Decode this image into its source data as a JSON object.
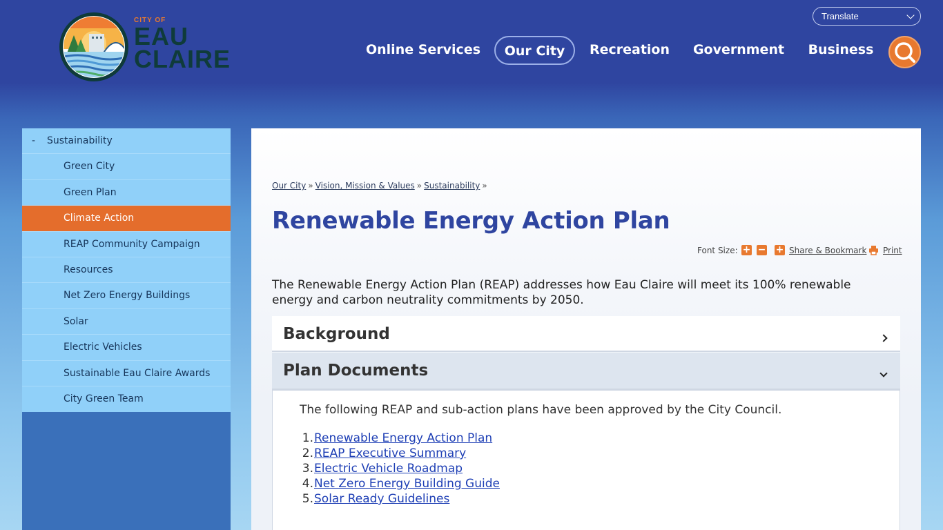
{
  "header": {
    "logo_small": "CITY OF",
    "logo_line1": "EAU",
    "logo_line2": "CLAIRE",
    "translate_label": "Translate",
    "nav": [
      {
        "label": "Online Services"
      },
      {
        "label": "Our City"
      },
      {
        "label": "Recreation"
      },
      {
        "label": "Government"
      },
      {
        "label": "Business"
      }
    ],
    "active_nav": "Our City"
  },
  "sidebar": {
    "parent": {
      "marker": "-",
      "label": "Sustainability"
    },
    "items": [
      {
        "label": "Green City"
      },
      {
        "label": "Green Plan"
      },
      {
        "label": "Climate Action"
      },
      {
        "label": "REAP Community Campaign"
      },
      {
        "label": "Resources"
      },
      {
        "label": "Net Zero Energy Buildings"
      },
      {
        "label": "Solar"
      },
      {
        "label": "Electric Vehicles"
      },
      {
        "label": "Sustainable Eau Claire Awards"
      },
      {
        "label": "City Green Team"
      }
    ],
    "active_item": "Climate Action"
  },
  "breadcrumb": {
    "items": [
      "Our City",
      "Vision, Mission & Values",
      "Sustainability"
    ],
    "separator": "»"
  },
  "page": {
    "title": "Renewable Energy Action Plan",
    "font_size_label": "Font Size:",
    "font_increase": "+",
    "font_decrease": "−",
    "share_label": "Share & Bookmark",
    "print_label": "Print",
    "intro": "The Renewable Energy Action Plan (REAP) addresses how Eau Claire will meet its 100% renewable energy and carbon neutrality commitments by 2050."
  },
  "accordion": {
    "background_title": "Background",
    "documents_title": "Plan Documents",
    "documents_intro": "The following REAP and sub-action plans have been approved by the City Council.",
    "documents": [
      {
        "num": "1.",
        "label": "Renewable Energy Action Plan"
      },
      {
        "num": "2.",
        "label": "REAP Executive Summary"
      },
      {
        "num": "3.",
        "label": "Electric Vehicle Roadmap"
      },
      {
        "num": "4.",
        "label": "Net Zero Energy Building Guide"
      },
      {
        "num": "5.",
        "label": "Solar Ready Guidelines"
      }
    ]
  },
  "colors": {
    "header_blue": "#2f45a0",
    "accent_orange": "#e8792f",
    "sidebar_light": "#90d0f9",
    "sidebar_dark": "#3a70ba",
    "link_blue": "#1e3fb5"
  },
  "icons": {
    "search": "search-icon",
    "translate_chevron": "chevron-down-icon",
    "font_plus": "plus-icon",
    "font_minus": "minus-icon",
    "share": "share-icon",
    "print": "printer-icon",
    "accordion_closed": "chevron-right-icon",
    "accordion_open": "chevron-down-icon"
  }
}
